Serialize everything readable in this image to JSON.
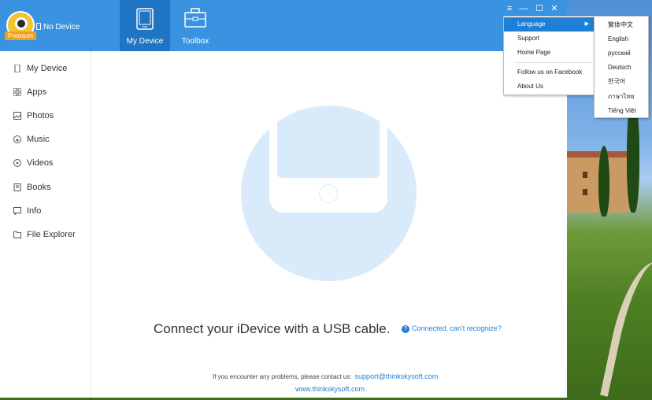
{
  "app": {
    "logo_badge": "Premium",
    "device_status": "No Device",
    "tabs": [
      {
        "label": "My Device",
        "active": true
      },
      {
        "label": "Toolbox",
        "active": false
      }
    ],
    "window_controls": [
      "menu-icon",
      "minimize-icon",
      "maximize-icon",
      "close-icon"
    ]
  },
  "sidebar": {
    "items": [
      {
        "label": "My Device",
        "icon": "phone-icon"
      },
      {
        "label": "Apps",
        "icon": "apps-grid-icon"
      },
      {
        "label": "Photos",
        "icon": "photo-icon"
      },
      {
        "label": "Music",
        "icon": "music-icon"
      },
      {
        "label": "Videos",
        "icon": "video-icon"
      },
      {
        "label": "Books",
        "icon": "book-icon"
      },
      {
        "label": "Info",
        "icon": "chat-icon"
      },
      {
        "label": "File Explorer",
        "icon": "folder-icon"
      }
    ]
  },
  "main": {
    "connect_text": "Connect your iDevice with a USB cable.",
    "help_link": "Connected, can't recognize?",
    "contact_text": "If you encounter any problems, please contact us:",
    "contact_email": "support@thinkskysoft.com",
    "website": "www.thinkskysoft.com"
  },
  "menu": {
    "items": [
      "Language",
      "Support",
      "Home Page",
      "Follow us on Facebook",
      "About Us"
    ],
    "highlighted": "Language"
  },
  "language_menu": {
    "items": [
      "繁体中文",
      "English",
      "русский",
      "Deutsch",
      "한국어",
      "ภาษาไทย",
      "Tiếng Việt"
    ]
  },
  "colors": {
    "header": "#3a93e0",
    "active_tab": "#1f74c4",
    "link": "#1e7fd4",
    "illustration": "#d9ebfa"
  }
}
